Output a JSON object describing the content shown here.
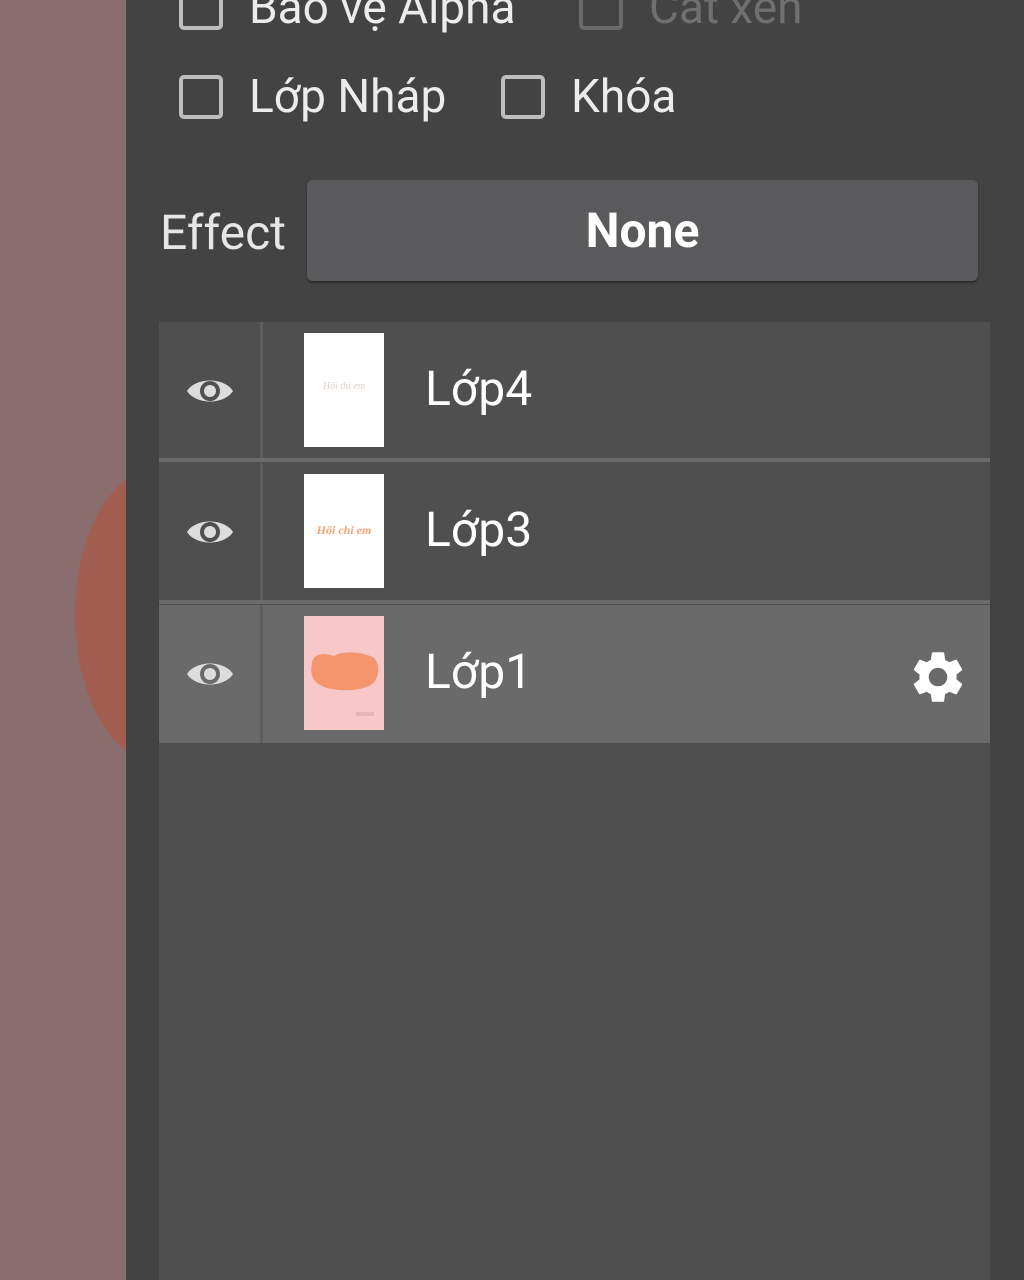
{
  "options": {
    "alpha_protect_label": "Bảo vệ Alpha",
    "clipping_label": "Cắt xén",
    "draft_layer_label": "Lớp Nháp",
    "lock_label": "Khóa"
  },
  "effect": {
    "label": "Effect",
    "value": "None"
  },
  "layers": [
    {
      "name": "Lớp4",
      "thumb_text": "Hôi thi em"
    },
    {
      "name": "Lớp3",
      "thumb_text": "Hôi chi em"
    },
    {
      "name": "Lớp1",
      "selected": true
    }
  ],
  "colors": {
    "panel": "#434343",
    "layer_list": "#4f4f4f",
    "selected_layer": "#6a6a6a",
    "canvas": "#8a6e6f",
    "thumb_pink": "#f8c7c8",
    "thumb_peach": "#f4956e"
  },
  "icons": {
    "visibility": "eye-icon",
    "settings": "gear-icon"
  }
}
